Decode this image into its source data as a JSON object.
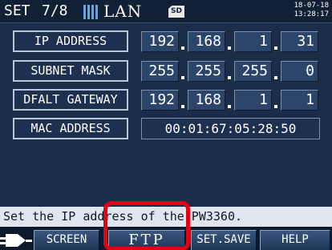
{
  "header": {
    "set_label": "SET",
    "page": "7/8",
    "section": "LAN",
    "sd_label": "SD",
    "date": "18-07-18",
    "time": "13:28:17"
  },
  "settings": {
    "ip_address": {
      "label": "IP ADDRESS",
      "octets": [
        "192",
        "168",
        "1",
        "31"
      ]
    },
    "subnet_mask": {
      "label": "SUBNET MASK",
      "octets": [
        "255",
        "255",
        "255",
        "0"
      ]
    },
    "default_gateway": {
      "label": "DFALT GATEWAY",
      "octets": [
        "192",
        "168",
        "1",
        "1"
      ]
    },
    "mac_address": {
      "label": "MAC ADDRESS",
      "value": "00:01:67:05:28:50"
    }
  },
  "status_message": "Set the IP address of the PW3360.",
  "function_keys": {
    "icon": "plug-icon",
    "screen": "SCREEN",
    "ftp": "FTP",
    "set_save": "SET.SAVE",
    "help": "HELP"
  },
  "colors": {
    "background": "#1b2d49",
    "highlight": "#e60012",
    "status_bar": "#dfe6ee"
  }
}
